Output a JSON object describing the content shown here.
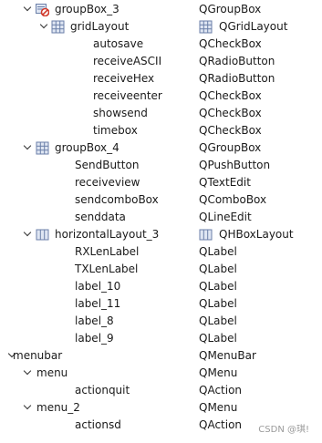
{
  "tree": {
    "rows": [
      {
        "indent": 1,
        "expand": "open",
        "icon": "groupbox-icon",
        "name": "groupBox_3",
        "cls": "QGroupBox"
      },
      {
        "indent": 2,
        "expand": "open",
        "icon": "grid-layout-icon",
        "name": "gridLayout",
        "cls": "QGridLayout",
        "cls_icon": "grid-layout-icon"
      },
      {
        "indent": 3,
        "expand": "none",
        "name": "autosave",
        "cls": "QCheckBox"
      },
      {
        "indent": 3,
        "expand": "none",
        "name": "receiveASCII",
        "cls": "QRadioButton"
      },
      {
        "indent": 3,
        "expand": "none",
        "name": "receiveHex",
        "cls": "QRadioButton"
      },
      {
        "indent": 3,
        "expand": "none",
        "name": "receiveenter",
        "cls": "QCheckBox"
      },
      {
        "indent": 3,
        "expand": "none",
        "name": "showsend",
        "cls": "QCheckBox"
      },
      {
        "indent": 3,
        "expand": "none",
        "name": "timebox",
        "cls": "QCheckBox"
      },
      {
        "indent": 1,
        "expand": "open",
        "icon": "grid-layout-icon",
        "name": "groupBox_4",
        "cls": "QGroupBox"
      },
      {
        "indent": 2,
        "expand": "none",
        "name": "SendButton",
        "cls": "QPushButton"
      },
      {
        "indent": 2,
        "expand": "none",
        "name": "receiveview",
        "cls": "QTextEdit"
      },
      {
        "indent": 2,
        "expand": "none",
        "name": "sendcomboBox",
        "cls": "QComboBox"
      },
      {
        "indent": 2,
        "expand": "none",
        "name": "senddata",
        "cls": "QLineEdit"
      },
      {
        "indent": 1,
        "expand": "open",
        "icon": "hbox-layout-icon",
        "name": "horizontalLayout_3",
        "cls": "QHBoxLayout",
        "cls_icon": "hbox-layout-icon"
      },
      {
        "indent": 2,
        "expand": "none",
        "name": "RXLenLabel",
        "cls": "QLabel"
      },
      {
        "indent": 2,
        "expand": "none",
        "name": "TXLenLabel",
        "cls": "QLabel"
      },
      {
        "indent": 2,
        "expand": "none",
        "name": "label_10",
        "cls": "QLabel"
      },
      {
        "indent": 2,
        "expand": "none",
        "name": "label_11",
        "cls": "QLabel"
      },
      {
        "indent": 2,
        "expand": "none",
        "name": "label_8",
        "cls": "QLabel"
      },
      {
        "indent": 2,
        "expand": "none",
        "name": "label_9",
        "cls": "QLabel"
      },
      {
        "indent": 0,
        "expand": "open",
        "name": "menubar",
        "cls": "QMenuBar"
      },
      {
        "indent": 1,
        "expand": "open",
        "name": "menu",
        "cls": "QMenu"
      },
      {
        "indent": 2,
        "expand": "none",
        "name": "actionquit",
        "cls": "QAction"
      },
      {
        "indent": 1,
        "expand": "open",
        "name": "menu_2",
        "cls": "QMenu"
      },
      {
        "indent": 2,
        "expand": "none",
        "name": "actionsd",
        "cls": "QAction"
      }
    ]
  },
  "colors": {
    "icon_grid": "#6b7fa8",
    "icon_grid_fill": "#dfe6f3",
    "icon_forbid": "#d0392b",
    "watermark": "#9a9a9a"
  },
  "watermark": "CSDN @琪!"
}
